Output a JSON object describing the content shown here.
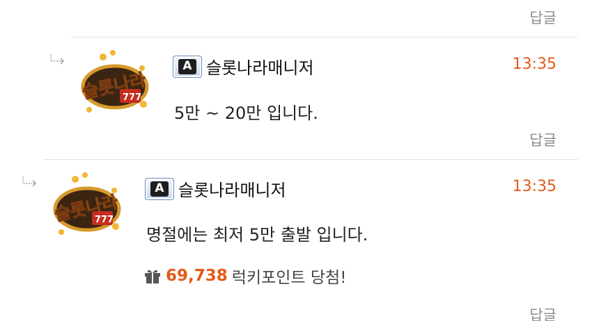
{
  "reply_label": "답글",
  "comments": [
    {
      "author": "슬롯나라매니저",
      "badge_letter": "A",
      "time": "13:35",
      "text": "5만 ~ 20만 입니다.",
      "avatar_text": "슬롯나라"
    },
    {
      "author": "슬롯나라매니저",
      "badge_letter": "A",
      "time": "13:35",
      "text": "명절에는 최저 5만 출발 입니다.",
      "avatar_text": "슬롯나라",
      "lucky": {
        "amount": "69,738",
        "text": "럭키포인트 당첨!"
      }
    }
  ],
  "colors": {
    "time": "#e35a1a",
    "lucky_amount": "#e35a1a"
  },
  "icons": [
    "reply-arrow-icon",
    "admin-badge-icon",
    "gift-icon"
  ]
}
